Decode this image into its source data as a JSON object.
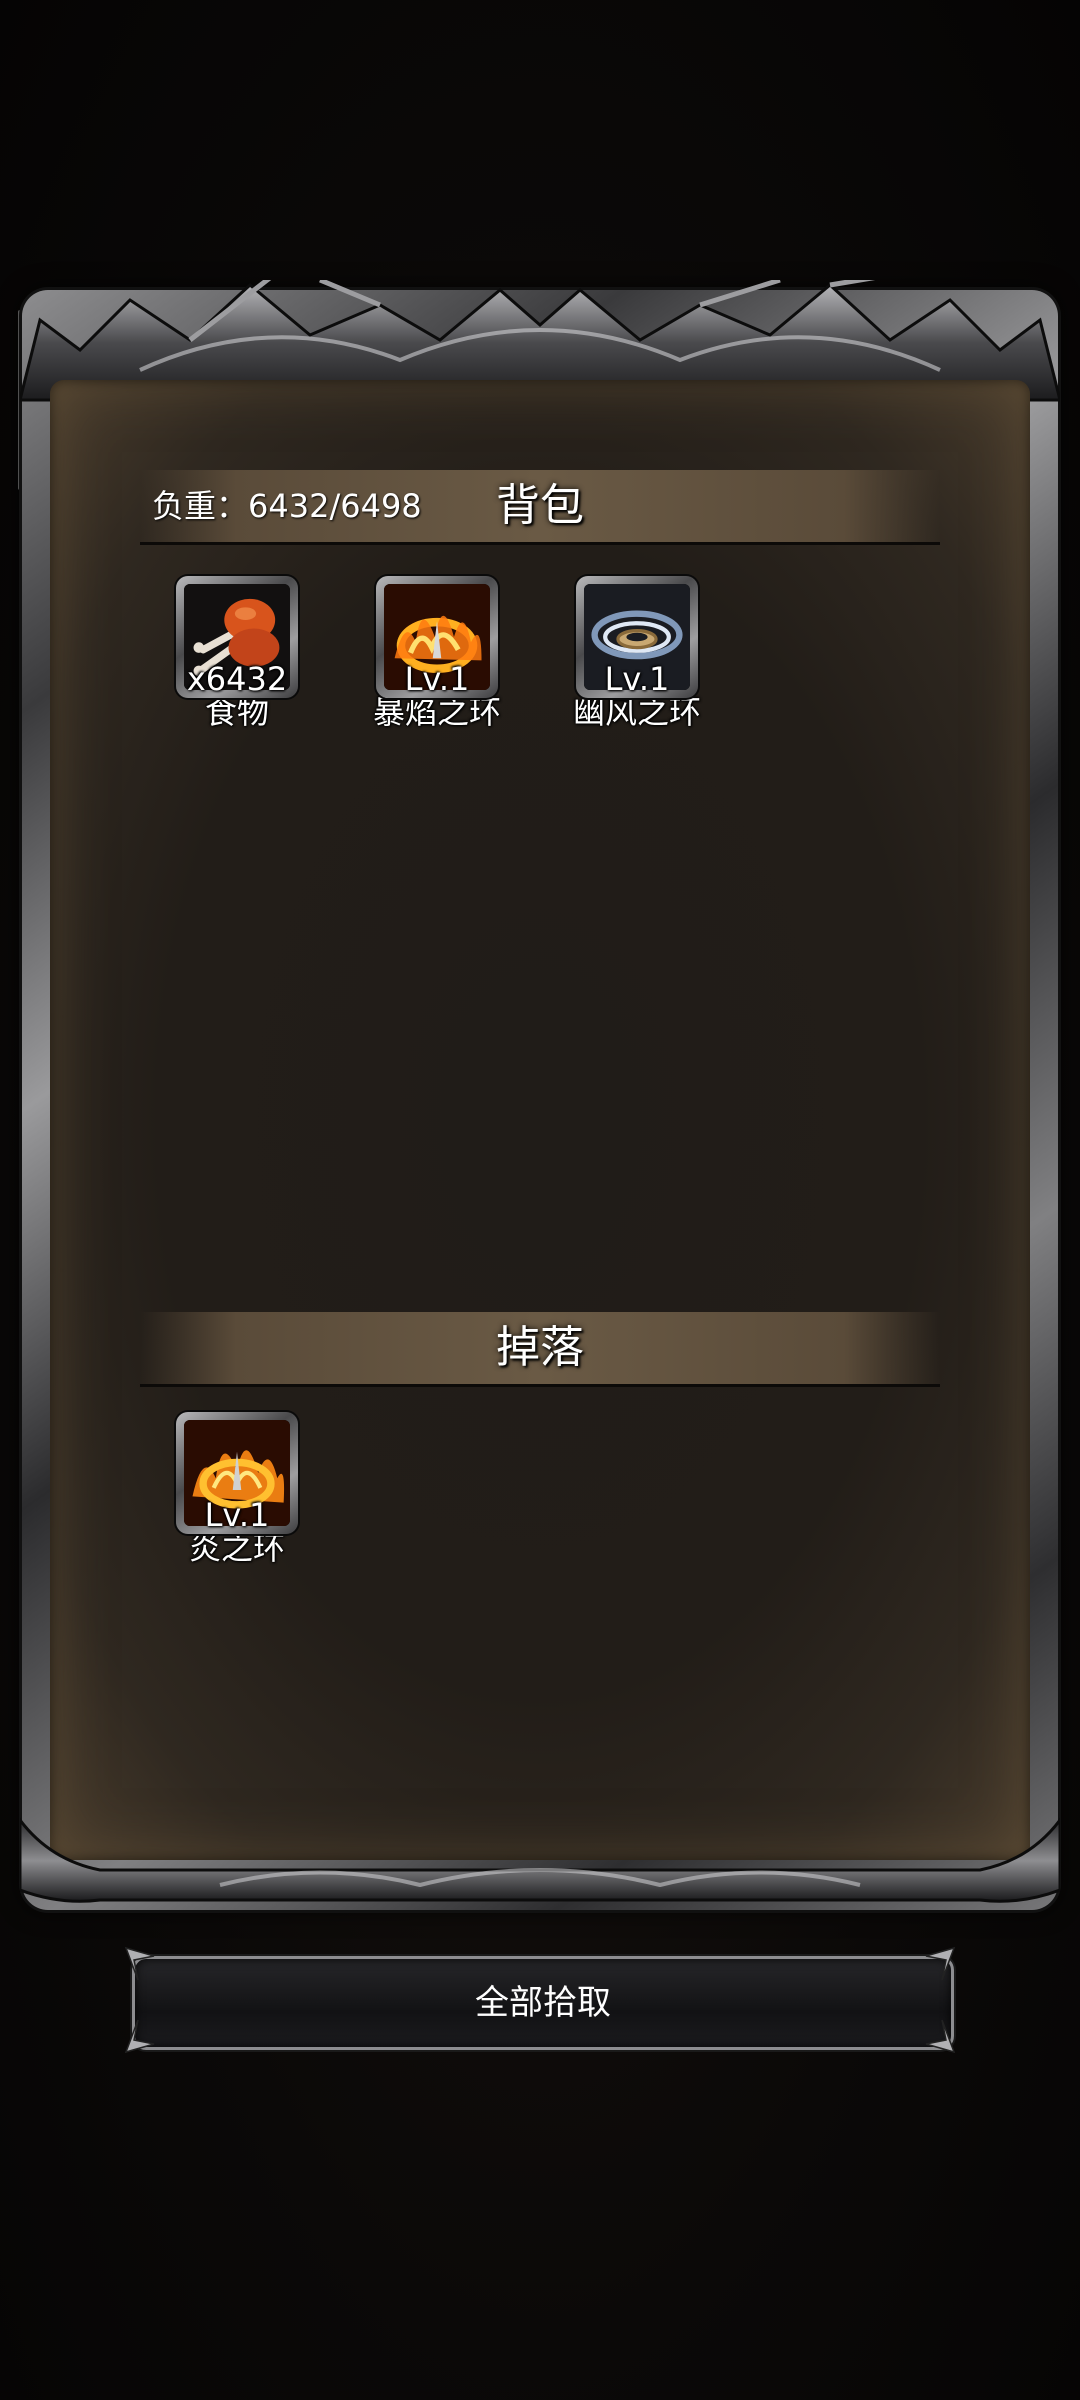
{
  "backpack": {
    "weight_label": "负重：6432/6498",
    "title": "背包",
    "items": [
      {
        "name": "食物",
        "badge": "x6432",
        "icon": "roast-meat-icon"
      },
      {
        "name": "暴焰之环",
        "badge": "Lv.1",
        "icon": "fire-ring-icon"
      },
      {
        "name": "幽风之环",
        "badge": "Lv.1",
        "icon": "wind-ring-icon"
      }
    ]
  },
  "drops": {
    "title": "掉落",
    "items": [
      {
        "name": "炎之环",
        "badge": "Lv.1",
        "icon": "flame-ring-icon"
      }
    ]
  },
  "actions": {
    "pick_all_label": "全部拾取"
  },
  "colors": {
    "text": "#ffffff",
    "panel_bg": "#221d18",
    "header_band": "#6a5a45",
    "frame_metal": "#8d8d8f"
  }
}
